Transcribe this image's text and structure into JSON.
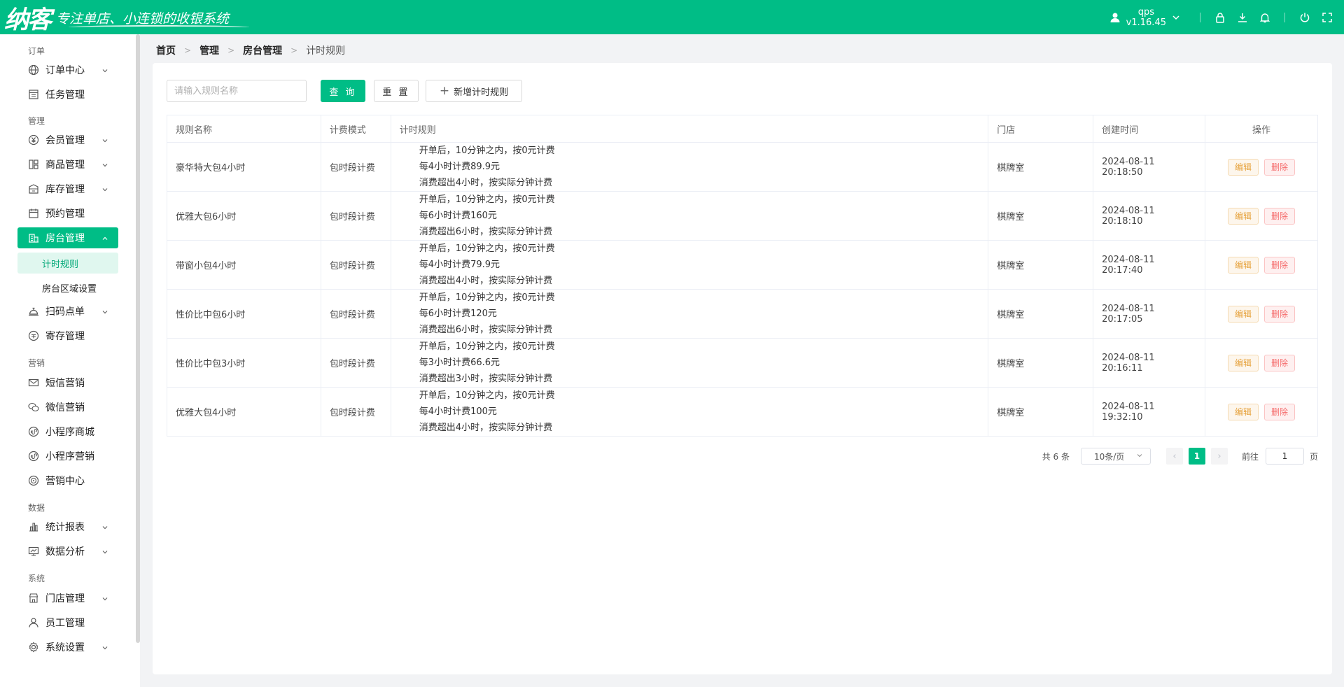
{
  "header": {
    "logo_text": "纳客",
    "slogan": "专注单店、小连锁的收银系统",
    "username": "qps",
    "version": "v1.16.45",
    "icons": [
      "user-icon",
      "lock-icon",
      "download-icon",
      "bell-icon",
      "power-icon",
      "fullscreen-icon"
    ]
  },
  "sidebar": {
    "sections": {
      "order": "订单",
      "manage": "管理",
      "marketing": "营销",
      "data": "数据",
      "system": "系统"
    },
    "items": {
      "order_center": "订单中心",
      "task_manage": "任务管理",
      "member_manage": "会员管理",
      "goods_manage": "商品管理",
      "stock_manage": "库存管理",
      "booking_manage": "预约管理",
      "room_manage": "房台管理",
      "timing_rules": "计时规则",
      "room_area": "房台区域设置",
      "scan_order": "扫码点单",
      "deposit_manage": "寄存管理",
      "sms_marketing": "短信营销",
      "wechat_marketing": "微信营销",
      "mini_shop": "小程序商城",
      "mini_marketing": "小程序营销",
      "marketing_center": "营销中心",
      "stats_report": "统计报表",
      "data_analysis": "数据分析",
      "store_manage": "门店管理",
      "staff_manage": "员工管理",
      "system_settings": "系统设置"
    }
  },
  "breadcrumb": [
    "首页",
    "管理",
    "房台管理",
    "计时规则"
  ],
  "toolbar": {
    "search_placeholder": "请输入规则名称",
    "query_label": "查 询",
    "reset_label": "重 置",
    "add_label": "新增计时规则"
  },
  "table": {
    "columns": [
      "规则名称",
      "计费模式",
      "计时规则",
      "门店",
      "创建时间",
      "操作"
    ],
    "edit_label": "编辑",
    "delete_label": "删除",
    "rows": [
      {
        "name": "豪华特大包4小时",
        "mode": "包时段计费",
        "rule": [
          "开单后，10分钟之内，按0元计费",
          "每4小时计费89.9元",
          "消费超出4小时，按实际分钟计费"
        ],
        "store": "棋牌室",
        "created": "2024-08-11 20:18:50"
      },
      {
        "name": "优雅大包6小时",
        "mode": "包时段计费",
        "rule": [
          "开单后，10分钟之内，按0元计费",
          "每6小时计费160元",
          "消费超出6小时，按实际分钟计费"
        ],
        "store": "棋牌室",
        "created": "2024-08-11 20:18:10"
      },
      {
        "name": "带窗小包4小时",
        "mode": "包时段计费",
        "rule": [
          "开单后，10分钟之内，按0元计费",
          "每4小时计费79.9元",
          "消费超出4小时，按实际分钟计费"
        ],
        "store": "棋牌室",
        "created": "2024-08-11 20:17:40"
      },
      {
        "name": "性价比中包6小时",
        "mode": "包时段计费",
        "rule": [
          "开单后，10分钟之内，按0元计费",
          "每6小时计费120元",
          "消费超出6小时，按实际分钟计费"
        ],
        "store": "棋牌室",
        "created": "2024-08-11 20:17:05"
      },
      {
        "name": "性价比中包3小时",
        "mode": "包时段计费",
        "rule": [
          "开单后，10分钟之内，按0元计费",
          "每3小时计费66.6元",
          "消费超出3小时，按实际分钟计费"
        ],
        "store": "棋牌室",
        "created": "2024-08-11 20:16:11"
      },
      {
        "name": "优雅大包4小时",
        "mode": "包时段计费",
        "rule": [
          "开单后，10分钟之内，按0元计费",
          "每4小时计费100元",
          "消费超出4小时，按实际分钟计费"
        ],
        "store": "棋牌室",
        "created": "2024-08-11 19:32:10"
      }
    ]
  },
  "pagination": {
    "total_text": "共 6 条",
    "page_size": "10条/页",
    "current_page": "1",
    "goto_label": "前往",
    "goto_value": "1",
    "page_suffix": "页"
  },
  "colors": {
    "brand": "#00bd86",
    "edit": "#e6a23c",
    "delete": "#f56c6c"
  }
}
